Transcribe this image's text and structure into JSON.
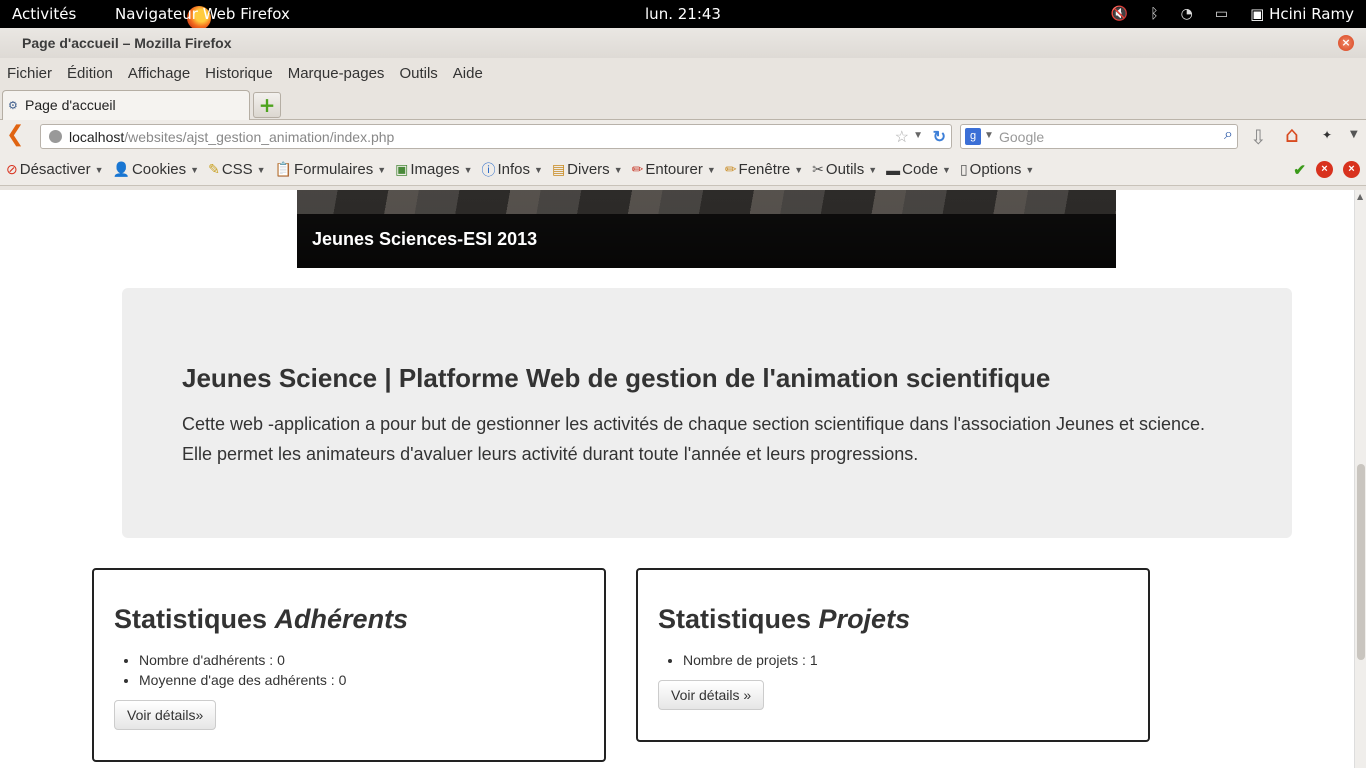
{
  "system_bar": {
    "activities": "Activités",
    "app_name": "Navigateur Web Firefox",
    "clock": "lun. 21:43",
    "user": "Hcini Ramy"
  },
  "window": {
    "title": "Page d'accueil – Mozilla Firefox"
  },
  "menu": [
    "Fichier",
    "Édition",
    "Affichage",
    "Historique",
    "Marque-pages",
    "Outils",
    "Aide"
  ],
  "tab": {
    "label": "Page d'accueil"
  },
  "navbar": {
    "url_host": "localhost",
    "url_path": "/websites/ajst_gestion_animation/index.php",
    "search_placeholder": "Google"
  },
  "devbar": [
    "Désactiver",
    "Cookies",
    "CSS",
    "Formulaires",
    "Images",
    "Infos",
    "Divers",
    "Entourer",
    "Fenêtre",
    "Outils",
    "Code",
    "Options"
  ],
  "carousel": {
    "caption": "Jeunes Sciences-ESI 2013"
  },
  "jumbotron": {
    "heading": "Jeunes Science | Platforme Web de gestion de l'animation scientifique",
    "line1": "Cette web -application a pour but de gestionner les activités de chaque section scientifique dans l'association Jeunes et science.",
    "line2": "Elle permet les animateurs d'avaluer leurs activité durant toute l'année et leurs progressions."
  },
  "stats_members": {
    "title_plain": "Statistiques ",
    "title_em": "Adhérents",
    "items": [
      "Nombre d'adhérents : 0",
      "Moyenne d'age des adhérents : 0"
    ],
    "button": "Voir détails»"
  },
  "stats_projects": {
    "title_plain": "Statistiques ",
    "title_em": "Projets",
    "items": [
      "Nombre de projets : 1"
    ],
    "button": "Voir détails »"
  },
  "colors": {
    "accent_firefox": "#e06412",
    "jumbotron_bg": "#eeeeee"
  }
}
